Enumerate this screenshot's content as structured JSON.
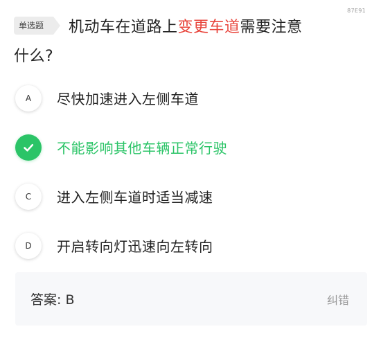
{
  "code": "87E91",
  "question": {
    "type_tag": "单选题",
    "text_before": "机动车在道路上",
    "text_highlight": "变更车道",
    "text_after": "需要注意",
    "text_line2": "什么?"
  },
  "options": [
    {
      "letter": "A",
      "text": "尽快加速进入左侧车道",
      "correct": false
    },
    {
      "letter": "B",
      "text": "不能影响其他车辆正常行驶",
      "correct": true
    },
    {
      "letter": "C",
      "text": "进入左侧车道时适当减速",
      "correct": false
    },
    {
      "letter": "D",
      "text": "开启转向灯迅速向左转向",
      "correct": false
    }
  ],
  "answer": {
    "label": "答案:",
    "value": "B",
    "correction_label": "纠错"
  },
  "colors": {
    "correct": "#2bc467",
    "highlight": "#e8453c"
  },
  "icons": {
    "correct_option": "checkmark-icon"
  }
}
